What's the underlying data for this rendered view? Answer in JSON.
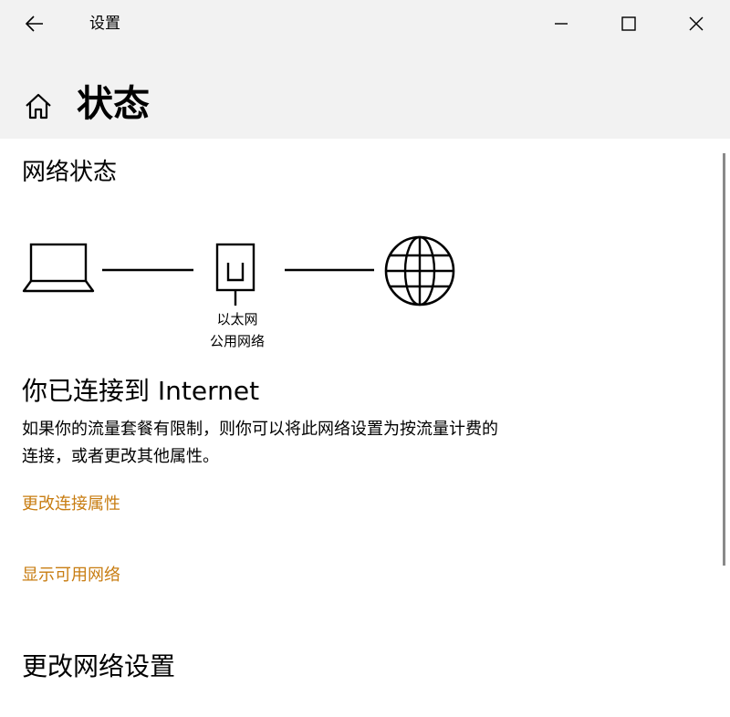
{
  "window": {
    "app_title": "设置",
    "back_icon": "arrow-left-icon",
    "minimize_icon": "minimize-icon",
    "maximize_icon": "maximize-icon",
    "close_icon": "close-icon"
  },
  "header": {
    "home_icon": "home-icon",
    "page_title": "状态"
  },
  "network_status": {
    "heading": "网络状态",
    "diagram": {
      "device_icon": "laptop-icon",
      "adapter_icon": "ethernet-icon",
      "internet_icon": "globe-icon",
      "adapter_name": "以太网",
      "network_type": "公用网络"
    },
    "connected_title": "你已连接到 Internet",
    "description_line1": "如果你的流量套餐有限制，则你可以将此网络设置为按流量计费的",
    "description_line2": "连接，或者更改其他属性。",
    "links": {
      "change_properties": "更改连接属性",
      "show_networks": "显示可用网络"
    }
  },
  "change_settings": {
    "heading": "更改网络设置"
  },
  "colors": {
    "titlebar_bg": "#f2f2f2",
    "link": "#c87d12"
  }
}
